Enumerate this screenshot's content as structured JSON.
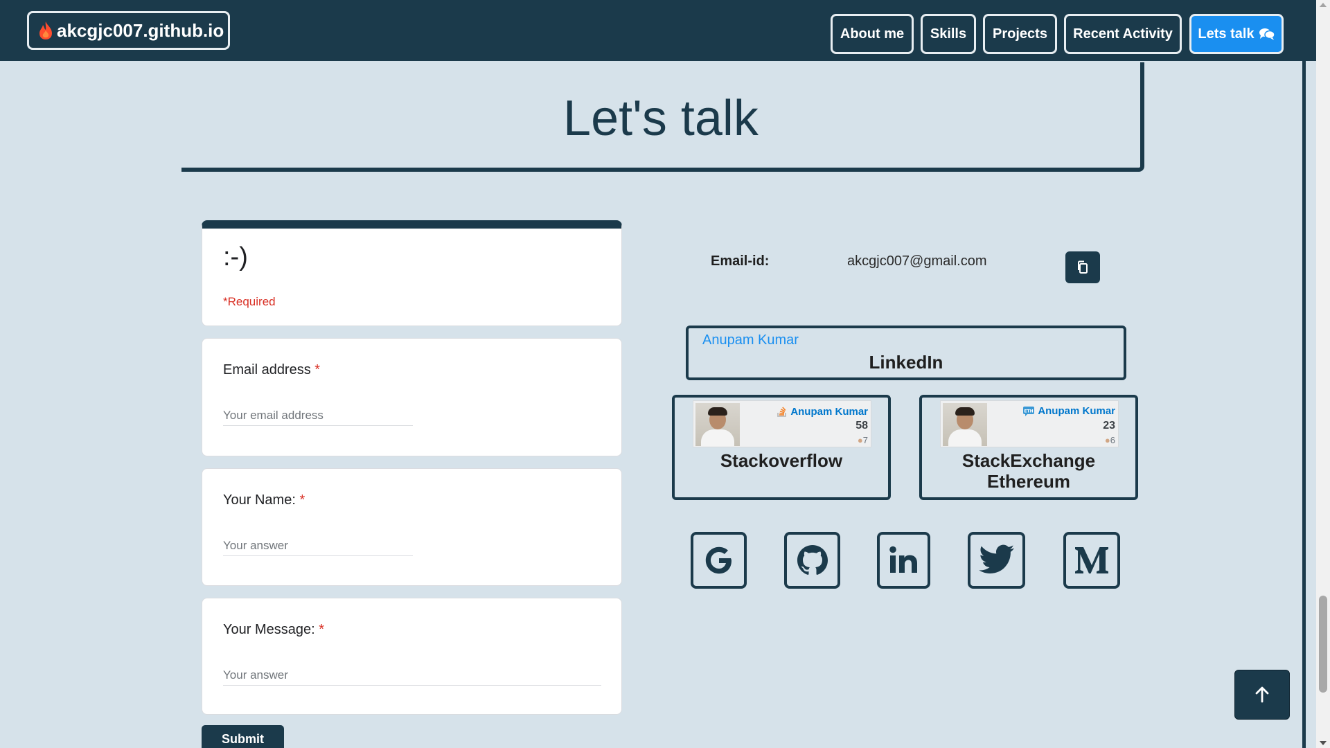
{
  "navbar": {
    "brand": "akcgjc007.github.io",
    "items": [
      {
        "label": "About me"
      },
      {
        "label": "Skills"
      },
      {
        "label": "Projects"
      },
      {
        "label": "Recent Activity"
      },
      {
        "label": "Lets talk"
      }
    ],
    "active_item": "Lets talk"
  },
  "section": {
    "title": "Let's talk"
  },
  "form": {
    "header": {
      "text": ":-)",
      "required_note": "*Required"
    },
    "questions": [
      {
        "label": "Email address",
        "required_mark": "*",
        "placeholder": "Your email address"
      },
      {
        "label": "Your Name:",
        "required_mark": "*",
        "placeholder": "Your answer"
      },
      {
        "label": "Your Message:",
        "required_mark": "*",
        "placeholder": "Your answer"
      }
    ],
    "submit_label": "Submit"
  },
  "contact": {
    "email_label": "Email-id:",
    "email_value": "akcgjc007@gmail.com",
    "linkedin": {
      "name": "Anupam Kumar",
      "title": "LinkedIn"
    },
    "stackoverflow": {
      "user": "Anupam Kumar",
      "reputation": "58",
      "badges": "7",
      "title": "Stackoverflow"
    },
    "stackexchange": {
      "user": "Anupam Kumar",
      "reputation": "23",
      "badges": "6",
      "title_line1": "StackExchange",
      "title_line2": "Ethereum"
    },
    "social_icons": [
      "google-icon",
      "github-icon",
      "linkedin-icon",
      "twitter-icon",
      "medium-icon"
    ]
  },
  "colors": {
    "primary": "#1b3a4b",
    "accent": "#1a8ff0",
    "background": "#d6e2ea",
    "required": "#d93025"
  }
}
